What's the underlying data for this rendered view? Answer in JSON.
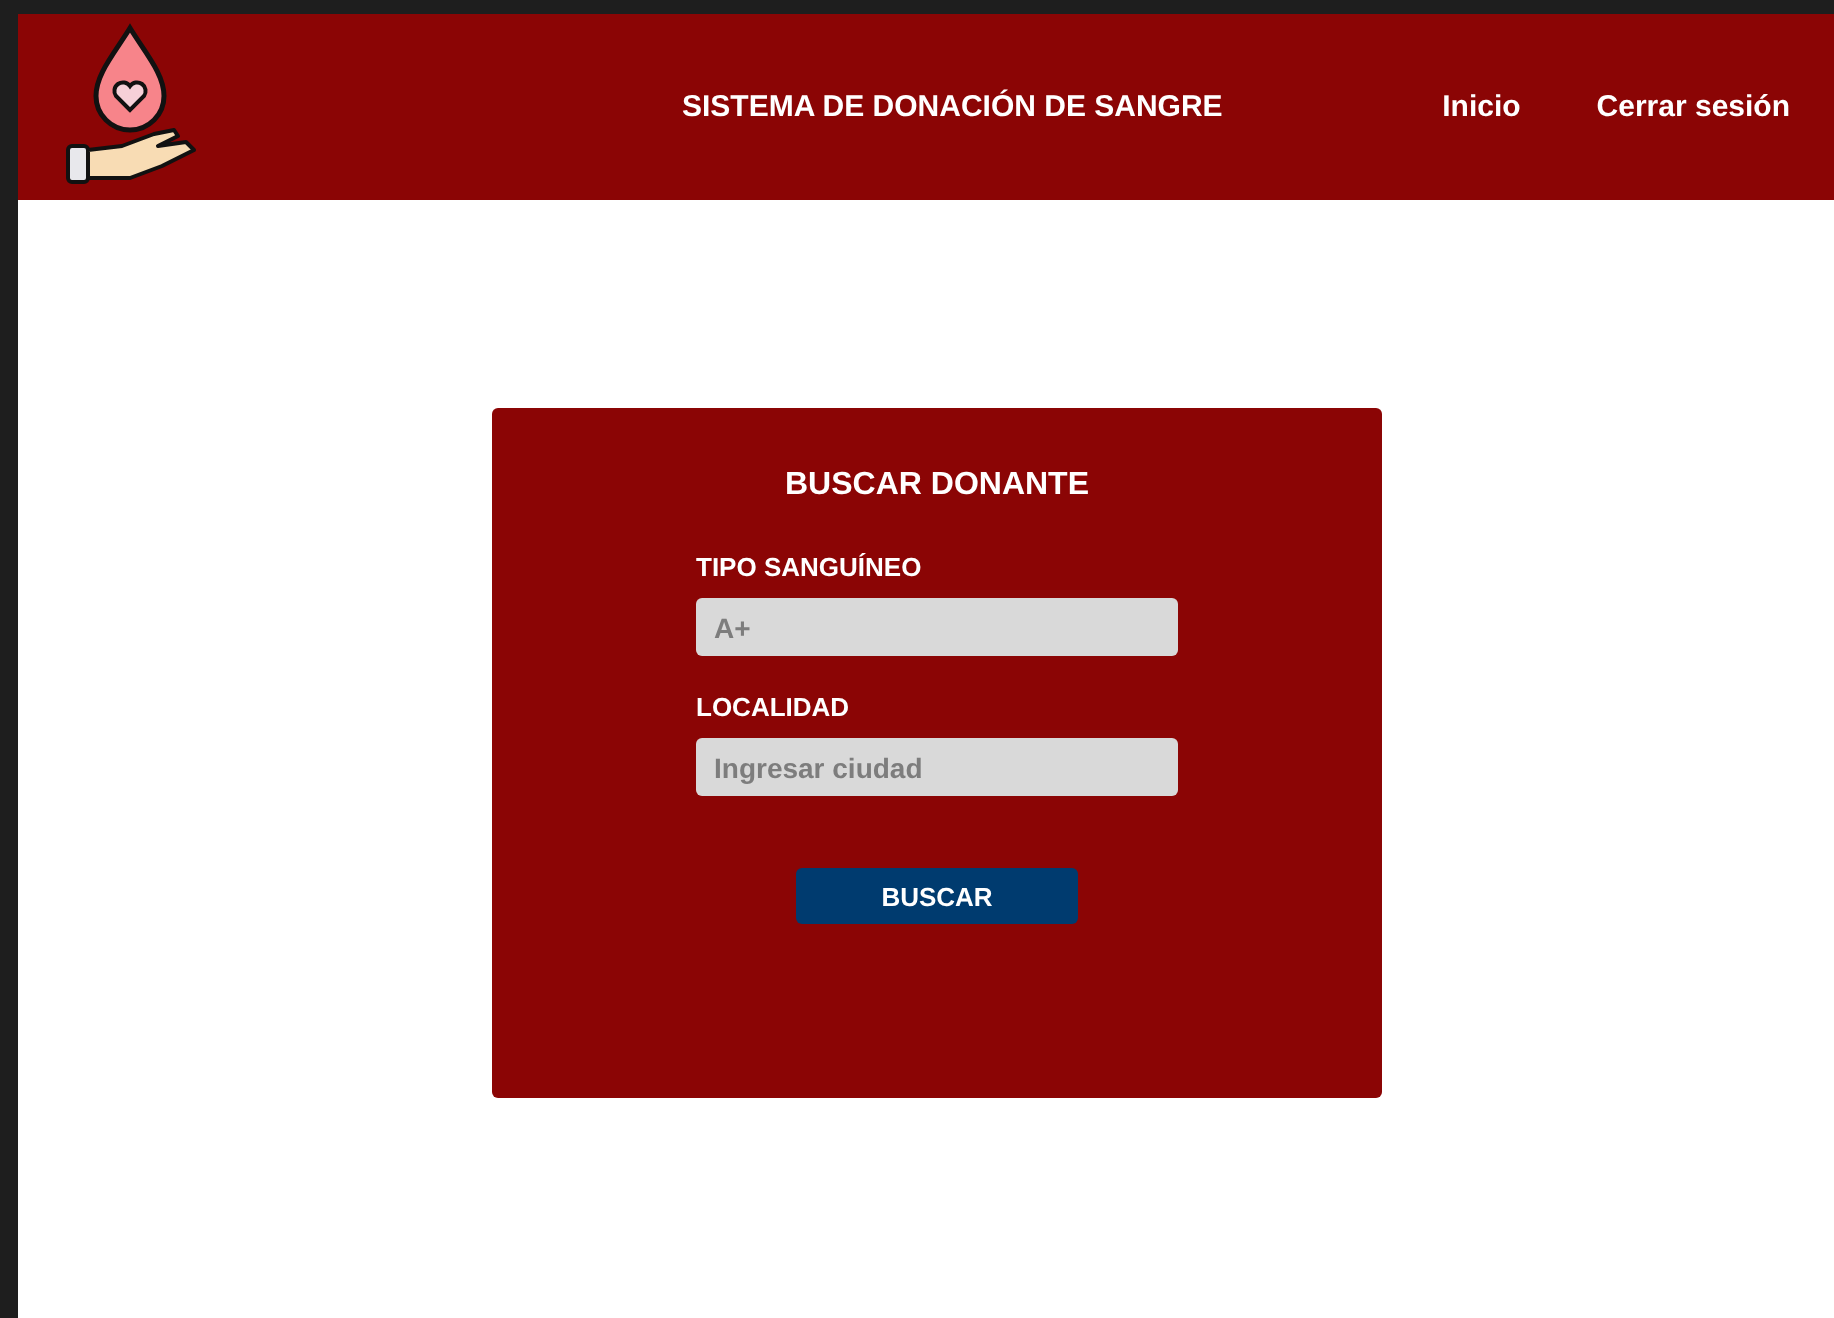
{
  "header": {
    "title": "SISTEMA DE DONACIÓN DE SANGRE",
    "nav": [
      {
        "label": "Inicio"
      },
      {
        "label": "Cerrar sesión"
      }
    ]
  },
  "form": {
    "title": "BUSCAR DONANTE",
    "fields": [
      {
        "label": "TIPO SANGUÍNEO",
        "placeholder": "A+"
      },
      {
        "label": "LOCALIDAD",
        "placeholder": "Ingresar ciudad"
      }
    ],
    "button": "BUSCAR"
  }
}
